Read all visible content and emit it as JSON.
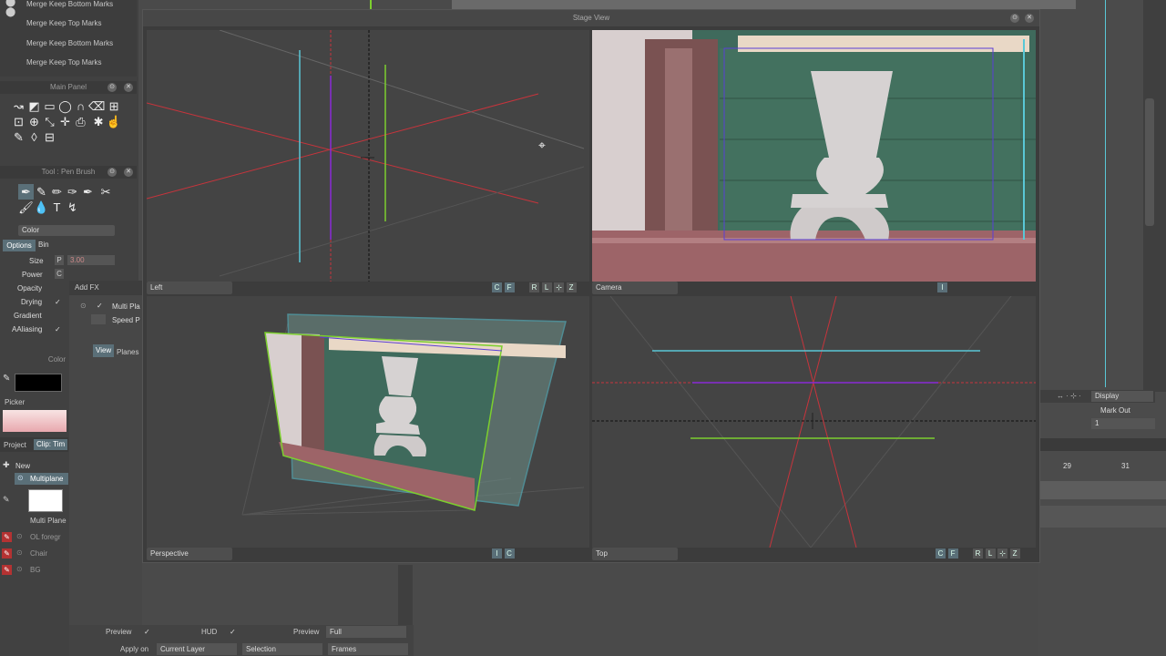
{
  "merge_menu": {
    "items": [
      "Merge Keep Bottom Marks",
      "Merge Keep Top Marks",
      "Merge Keep Bottom Marks",
      "Merge Keep Top Marks"
    ]
  },
  "main_panel": {
    "title": "Main Panel"
  },
  "tool_panel": {
    "title": "Tool : Pen Brush",
    "color_combo": "Color",
    "tabs": [
      "Options",
      "Bin"
    ],
    "rows": {
      "size_label": "Size",
      "size_value": "3.00",
      "power_label": "Power",
      "opacity_label": "Opacity",
      "drying_label": "Drying",
      "gradient_label": "Gradient",
      "aaliasing_label": "AAliasing",
      "check": "✓"
    },
    "color_header": "Color",
    "picker_label": "Picker"
  },
  "project_panel": {
    "tab_project": "Project",
    "tab_clip": "Clip: Tim",
    "new_label": "New",
    "multiplane_label": "Multiplane",
    "thumb_label": "Multi Plane",
    "layers": [
      "OL foregr",
      "Chair",
      "BG"
    ]
  },
  "add_fx": {
    "title": "Add FX",
    "items": [
      "Multi Pla",
      "Speed P"
    ],
    "view_tab": "View",
    "planes_tab": "Planes"
  },
  "stage_view": {
    "title": "Stage View",
    "viewports": {
      "left": {
        "label": "Left",
        "buttons": [
          "C",
          "F",
          "R",
          "L",
          "⊹",
          "Z"
        ]
      },
      "camera": {
        "label": "Camera",
        "buttons": [
          "I"
        ]
      },
      "perspective": {
        "label": "Perspective",
        "buttons": [
          "I",
          "C"
        ]
      },
      "top": {
        "label": "Top",
        "buttons": [
          "C",
          "F",
          "R",
          "L",
          "⊹",
          "Z"
        ]
      }
    }
  },
  "right_side": {
    "display_label": "Display",
    "mark_out_label": "Mark Out",
    "frame_value": "1",
    "frame_29": "29",
    "frame_31": "31"
  },
  "bottom_bar": {
    "preview_label": "Preview",
    "hud_label": "HUD",
    "preview2_label": "Preview",
    "preview2_value": "Full",
    "apply_on_label": "Apply on",
    "apply_on_value": "Current Layer",
    "selection_value": "Selection",
    "frames_value": "Frames",
    "check": "✓"
  },
  "colors": {
    "accent_cyan": "#59c7d6",
    "axis_red": "#c7343c",
    "axis_green": "#7ccf2e",
    "axis_purple": "#8a2ad6",
    "tab_active": "#5a6f78"
  }
}
